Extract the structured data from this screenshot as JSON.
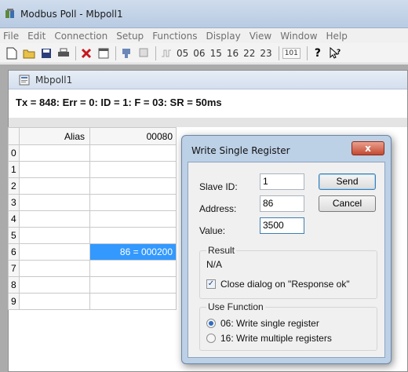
{
  "app": {
    "title": "Modbus Poll - Mbpoll1",
    "menu": [
      "File",
      "Edit",
      "Connection",
      "Setup",
      "Functions",
      "Display",
      "View",
      "Window",
      "Help"
    ],
    "toolbar_numbers": [
      "05",
      "06",
      "15",
      "16",
      "22",
      "23"
    ],
    "toolbar_small": "101",
    "toolbar_help": "?"
  },
  "child": {
    "title": "Mbpoll1",
    "status": "Tx = 848: Err = 0: ID = 1: F = 03: SR = 50ms"
  },
  "grid": {
    "columns": [
      "Alias",
      "00080"
    ],
    "rows": [
      "0",
      "1",
      "2",
      "3",
      "4",
      "5",
      "6",
      "7",
      "8",
      "9"
    ],
    "selected_value": "86 = 000200"
  },
  "dialog": {
    "title": "Write Single Register",
    "close_label": "x",
    "slave_id_label": "Slave ID:",
    "slave_id_value": "1",
    "address_label": "Address:",
    "address_value": "86",
    "value_label": "Value:",
    "value_value": "3500",
    "send_label": "Send",
    "cancel_label": "Cancel",
    "result_group": "Result",
    "result_value": "N/A",
    "close_on_response_label": "Close dialog on \"Response ok\"",
    "close_on_response_checked": true,
    "use_function_group": "Use Function",
    "options": [
      "06: Write single register",
      "16: Write multiple registers"
    ],
    "selected_option": 0
  }
}
